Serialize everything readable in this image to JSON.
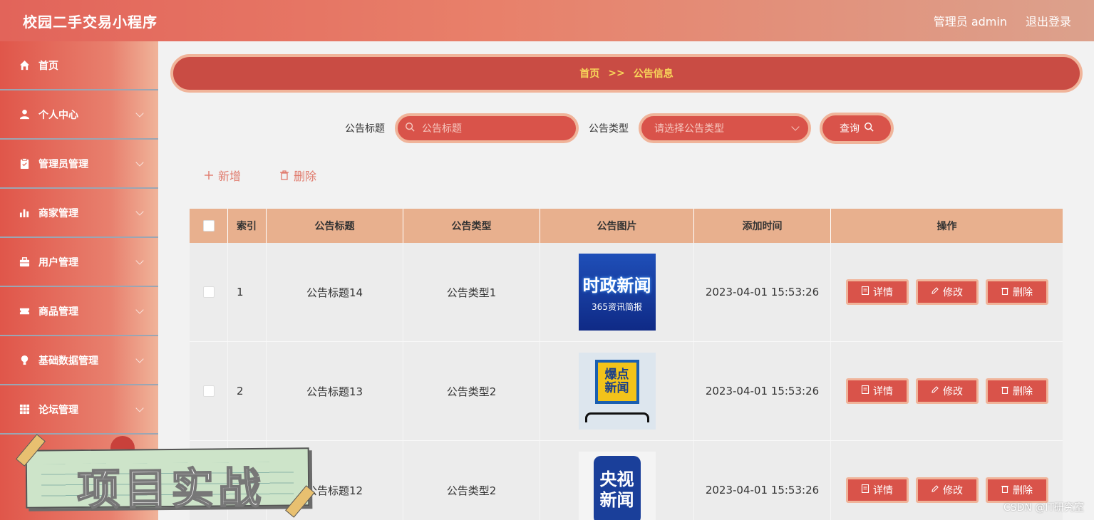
{
  "header": {
    "app_title": "校园二手交易小程序",
    "admin_label": "管理员 admin",
    "logout_label": "退出登录"
  },
  "sidebar": {
    "items": [
      {
        "label": "首页",
        "icon": "home-icon"
      },
      {
        "label": "个人中心",
        "icon": "user-icon"
      },
      {
        "label": "管理员管理",
        "icon": "clipboard-icon"
      },
      {
        "label": "商家管理",
        "icon": "bar-chart-icon"
      },
      {
        "label": "用户管理",
        "icon": "briefcase-icon"
      },
      {
        "label": "商品管理",
        "icon": "ticket-icon"
      },
      {
        "label": "基础数据管理",
        "icon": "lightbulb-icon"
      },
      {
        "label": "论坛管理",
        "icon": "grid-icon"
      }
    ]
  },
  "breadcrumb": {
    "home": "首页",
    "separator": ">>",
    "current": "公告信息"
  },
  "search": {
    "title_label": "公告标题",
    "title_placeholder": "公告标题",
    "type_label": "公告类型",
    "type_placeholder": "请选择公告类型",
    "query_label": "查询"
  },
  "actions": {
    "add_label": "新增",
    "delete_label": "删除"
  },
  "table": {
    "headers": [
      "索引",
      "公告标题",
      "公告类型",
      "公告图片",
      "添加时间",
      "操作"
    ],
    "rows": [
      {
        "index": "1",
        "title": "公告标题14",
        "type": "公告类型1",
        "image": "时政新闻",
        "image_sub": "365资讯简报",
        "time": "2023-04-01 15:53:26"
      },
      {
        "index": "2",
        "title": "公告标题13",
        "type": "公告类型2",
        "image": "爆点新闻",
        "image_sub": "",
        "time": "2023-04-01 15:53:26"
      },
      {
        "index": "",
        "title": "公告标题12",
        "type": "公告类型2",
        "image": "央视新闻",
        "image_sub": "",
        "time": "2023-04-01 15:53:26"
      }
    ],
    "op_labels": {
      "detail": "详情",
      "edit": "修改",
      "delete": "删除"
    }
  },
  "overlay": {
    "text": "项目实战"
  },
  "watermark": "CSDN @IT研究室",
  "colors": {
    "primary": "#d9534a",
    "accent_border": "#f0b49a",
    "breadcrumb_text": "#f8d65a",
    "table_header": "#e8b08e"
  }
}
